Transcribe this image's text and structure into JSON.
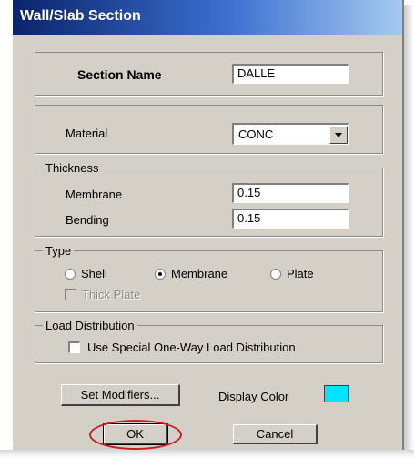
{
  "window": {
    "title": "Wall/Slab Section"
  },
  "section_name": {
    "label": "Section Name",
    "value": "DALLE"
  },
  "material": {
    "label": "Material",
    "selected": "CONC"
  },
  "thickness": {
    "legend": "Thickness",
    "membrane_label": "Membrane",
    "membrane_value": "0.15",
    "bending_label": "Bending",
    "bending_value": "0.15"
  },
  "type": {
    "legend": "Type",
    "options": [
      {
        "label": "Shell",
        "selected": false
      },
      {
        "label": "Membrane",
        "selected": true
      },
      {
        "label": "Plate",
        "selected": false
      }
    ],
    "thick_plate_label": "Thick Plate",
    "thick_plate_checked": false,
    "thick_plate_enabled": false
  },
  "load_distribution": {
    "legend": "Load Distribution",
    "checkbox_label": "Use Special One-Way Load Distribution",
    "checked": false
  },
  "buttons": {
    "set_modifiers": "Set Modifiers...",
    "display_color_label": "Display Color",
    "ok": "OK",
    "cancel": "Cancel"
  },
  "colors": {
    "display_color": "#00e5ff",
    "title_bar": "#0a246a",
    "annotation_oval": "#c81e1e"
  }
}
